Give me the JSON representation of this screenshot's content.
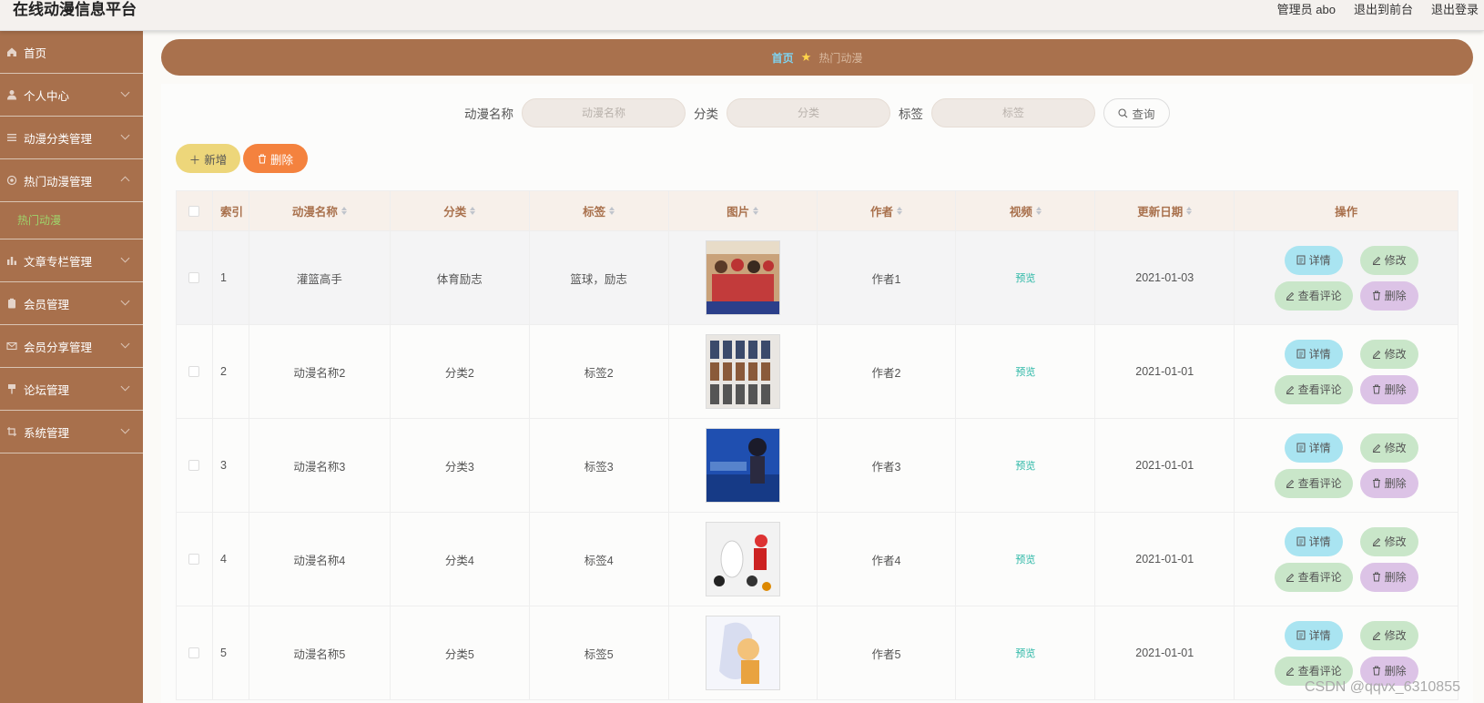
{
  "app": {
    "title": "在线动漫信息平台",
    "admin_label": "管理员 abo",
    "to_front": "退出到前台",
    "logout": "退出登录"
  },
  "sidebar": {
    "items": [
      {
        "label": "首页",
        "icon": "home-icon",
        "expandable": false
      },
      {
        "label": "个人中心",
        "icon": "user-icon",
        "expandable": true
      },
      {
        "label": "动漫分类管理",
        "icon": "list-icon",
        "expandable": true
      },
      {
        "label": "热门动漫管理",
        "icon": "gear-icon",
        "expandable": true,
        "expanded": true,
        "sub": [
          "热门动漫"
        ]
      },
      {
        "label": "文章专栏管理",
        "icon": "chart-icon",
        "expandable": true
      },
      {
        "label": "会员管理",
        "icon": "clipboard-icon",
        "expandable": true
      },
      {
        "label": "会员分享管理",
        "icon": "mail-icon",
        "expandable": true
      },
      {
        "label": "论坛管理",
        "icon": "flag-icon",
        "expandable": true
      },
      {
        "label": "系统管理",
        "icon": "crop-icon",
        "expandable": true
      }
    ]
  },
  "breadcrumb": {
    "home": "首页",
    "current": "热门动漫"
  },
  "search": {
    "name_label": "动漫名称",
    "name_placeholder": "动漫名称",
    "category_label": "分类",
    "category_placeholder": "分类",
    "tag_label": "标签",
    "tag_placeholder": "标签",
    "query_button": "查询"
  },
  "actions": {
    "add": "新增",
    "delete": "删除"
  },
  "table": {
    "headers": [
      "索引",
      "动漫名称",
      "分类",
      "标签",
      "图片",
      "作者",
      "视频",
      "更新日期",
      "操作"
    ],
    "rows": [
      {
        "index": "1",
        "name": "灌篮高手",
        "category": "体育励志",
        "tag": "篮球，励志",
        "author": "作者1",
        "video": "预览",
        "date": "2021-01-03"
      },
      {
        "index": "2",
        "name": "动漫名称2",
        "category": "分类2",
        "tag": "标签2",
        "author": "作者2",
        "video": "预览",
        "date": "2021-01-01"
      },
      {
        "index": "3",
        "name": "动漫名称3",
        "category": "分类3",
        "tag": "标签3",
        "author": "作者3",
        "video": "预览",
        "date": "2021-01-01"
      },
      {
        "index": "4",
        "name": "动漫名称4",
        "category": "分类4",
        "tag": "标签4",
        "author": "作者4",
        "video": "预览",
        "date": "2021-01-01"
      },
      {
        "index": "5",
        "name": "动漫名称5",
        "category": "分类5",
        "tag": "标签5",
        "author": "作者5",
        "video": "预览",
        "date": "2021-01-01"
      }
    ],
    "ops": {
      "detail": "详情",
      "edit": "修改",
      "comments": "查看评论",
      "delete": "删除"
    }
  },
  "watermark": "CSDN @qqvx_6310855",
  "colors": {
    "sidebar": "#a8704c",
    "breadcrumb": "#a9714d",
    "accent_text": "#a9714d",
    "add_btn": "#edd67a",
    "del_btn": "#f4823e"
  }
}
